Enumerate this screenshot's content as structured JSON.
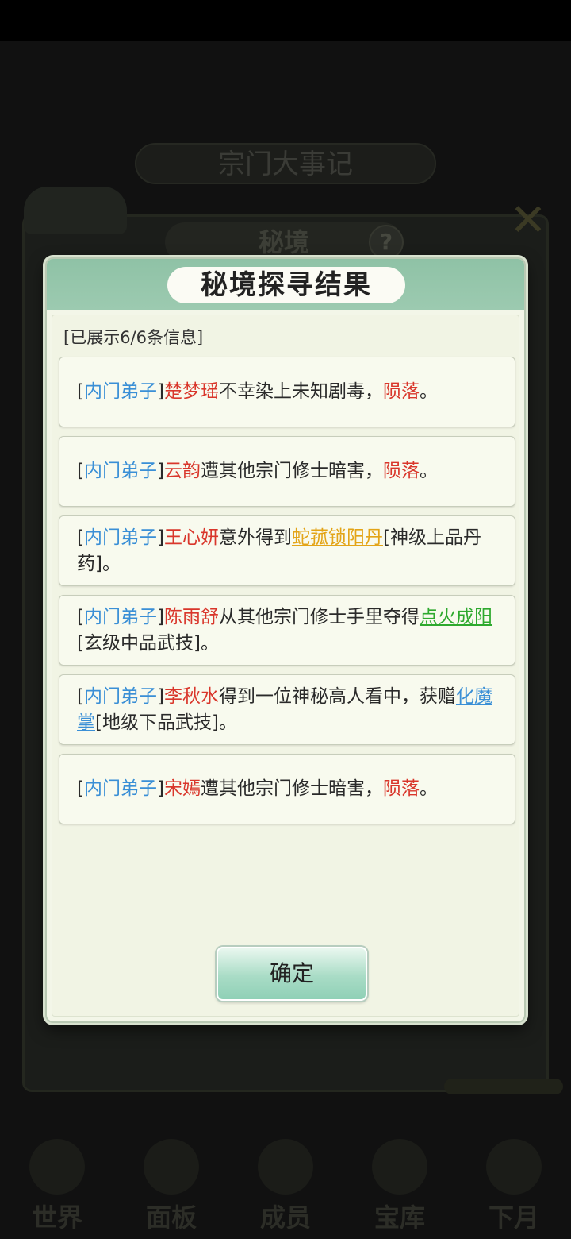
{
  "background": {
    "event_title": "宗门大事记",
    "panel_tab": "秘境",
    "help_icon": "question-icon",
    "nav": [
      "世界",
      "面板",
      "成员",
      "宝库",
      "下月"
    ]
  },
  "modal": {
    "title": "秘境探寻结果",
    "info_count": "[已展示6/6条信息]",
    "confirm_label": "确定",
    "cards": [
      {
        "tag": "内门弟子",
        "name": "楚梦瑶",
        "text": "不幸染上未知剧毒，",
        "result": "陨落",
        "end": "。"
      },
      {
        "tag": "内门弟子",
        "name": "云韵",
        "text": "遭其他宗门修士暗害，",
        "result": "陨落",
        "end": "。"
      },
      {
        "tag": "内门弟子",
        "name": "王心妍",
        "text": "意外得到",
        "item": "蛇菰锁阳丹",
        "grade": "[神级上品丹药]",
        "end": "。"
      },
      {
        "tag": "内门弟子",
        "name": "陈雨舒",
        "text": "从其他宗门修士手里夺得",
        "item": "点火成阳",
        "grade": "[玄级中品武技]",
        "end": "。"
      },
      {
        "tag": "内门弟子",
        "name": "李秋水",
        "text": "得到一位神秘高人看中，获赠",
        "item": "化魔掌",
        "grade": "[地级下品武技]",
        "end": "。"
      },
      {
        "tag": "内门弟子",
        "name": "宋嫣",
        "text": "遭其他宗门修士暗害，",
        "result": "陨落",
        "end": "。"
      }
    ]
  }
}
